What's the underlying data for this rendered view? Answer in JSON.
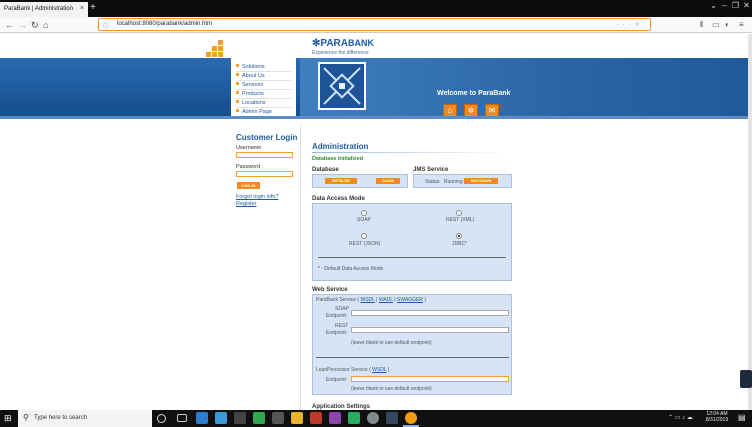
{
  "browser": {
    "tab_title": "ParaBank | Administration",
    "url": "localhost:8080/parabank/admin.htm"
  },
  "site": {
    "brand_para": "PARA",
    "brand_bank": "BANK",
    "tagline": "Experience the difference",
    "welcome": "Welcome to ParaBank"
  },
  "menu": [
    "Solutions",
    "About Us",
    "Services",
    "Products",
    "Locations",
    "Admin Page"
  ],
  "login": {
    "title": "Customer Login",
    "username_label": "Username",
    "password_label": "Password",
    "button": "LOG IN",
    "forgot": "Forgot login info?",
    "register": "Register"
  },
  "admin": {
    "title": "Administration",
    "status": "Database Initialized",
    "database": {
      "heading": "Database",
      "initialize": "INITIALIZE",
      "clean": "CLEAN"
    },
    "jms": {
      "heading": "JMS Service",
      "status_label": "Status:",
      "status": "Running",
      "shutdown": "SHUTDOWN"
    },
    "data_access": {
      "heading": "Data Access Mode",
      "soap": "SOAP",
      "rest_xml": "REST (XML)",
      "rest_json": "REST (JSON)",
      "jdbc": "JDBC*",
      "selected": "JDBC*",
      "note": "* - Default Data Access Mode"
    },
    "web_service": {
      "heading": "Web Service",
      "parabank_service": "ParaBank Service",
      "wsdl": "WSDL",
      "wadl": "WADL",
      "swagger": "SWAGGER",
      "soap_label": "SOAP",
      "rest_label": "REST",
      "endpoint_label": "Endpoint:",
      "hint": "(leave blank to use default endpoint)",
      "loan_service": "LoanProcessor Service",
      "loan_wsdl": "WSDL",
      "loan_hint": "(leave blank to use default endpoint)"
    },
    "next_heading": "Application Settings"
  },
  "taskbar": {
    "search_placeholder": "Type here to search",
    "time": "12:04 AM",
    "date": "8/31/2019"
  },
  "colors": {
    "brand_blue": "#1f5aa6",
    "orange": "#f08a1e",
    "box_blue": "#d6e4f5"
  }
}
